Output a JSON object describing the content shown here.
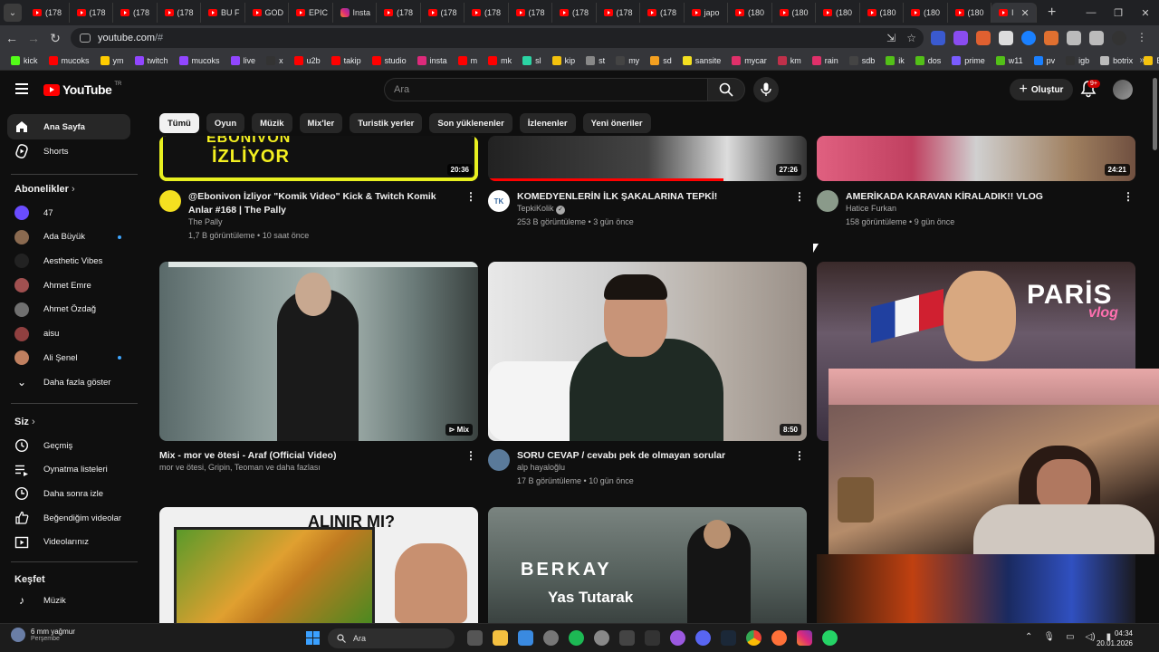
{
  "browser": {
    "tabs": [
      "(178",
      "(178",
      "(178",
      "(178",
      "BU F",
      "GOD",
      "EPIC",
      "Insta",
      "(178",
      "(178",
      "(178",
      "(178",
      "(178",
      "(178",
      "(178",
      "japo",
      "(180",
      "(180",
      "(180",
      "(180",
      "(180",
      "(180",
      "I"
    ],
    "tab_icons": [
      "yt",
      "yt",
      "yt",
      "yt",
      "yt",
      "yt",
      "yt",
      "ig",
      "yt",
      "yt",
      "yt",
      "yt",
      "yt",
      "yt",
      "yt",
      "yt",
      "yt",
      "yt",
      "yt",
      "yt",
      "yt",
      "yt",
      "yt"
    ],
    "url_host": "youtube.com",
    "url_path": "/#",
    "bookmarks": [
      {
        "label": "kick",
        "color": "#53fc18"
      },
      {
        "label": "mucoks",
        "color": "#ff0000"
      },
      {
        "label": "ym",
        "color": "#ffcc00"
      },
      {
        "label": "twitch",
        "color": "#9146ff"
      },
      {
        "label": "mucoks",
        "color": "#9146ff"
      },
      {
        "label": "live",
        "color": "#9146ff"
      },
      {
        "label": "x",
        "color": "#333333"
      },
      {
        "label": "u2b",
        "color": "#ff0000"
      },
      {
        "label": "takip",
        "color": "#ff0000"
      },
      {
        "label": "studio",
        "color": "#ff0000"
      },
      {
        "label": "insta",
        "color": "#dd2a7b"
      },
      {
        "label": "m",
        "color": "#ff0000"
      },
      {
        "label": "mk",
        "color": "#ff0000"
      },
      {
        "label": "sl",
        "color": "#2bd4a4"
      },
      {
        "label": "kip",
        "color": "#f4c20d"
      },
      {
        "label": "st",
        "color": "#888888"
      },
      {
        "label": "my",
        "color": "#444444"
      },
      {
        "label": "sd",
        "color": "#f4a020"
      },
      {
        "label": "sansite",
        "color": "#f4e020"
      },
      {
        "label": "mycar",
        "color": "#e0306a"
      },
      {
        "label": "km",
        "color": "#c0304a"
      },
      {
        "label": "rain",
        "color": "#e0306a"
      },
      {
        "label": "sdb",
        "color": "#444444"
      },
      {
        "label": "ik",
        "color": "#53c018"
      },
      {
        "label": "dos",
        "color": "#53c018"
      },
      {
        "label": "prime",
        "color": "#7a5cff"
      },
      {
        "label": "w11",
        "color": "#53c018"
      },
      {
        "label": "pv",
        "color": "#1a80ff"
      },
      {
        "label": "igb",
        "color": "#333333"
      },
      {
        "label": "botrix",
        "color": "#bbbbbb"
      },
      {
        "label": "ByNo",
        "color": "#f4c20d"
      }
    ]
  },
  "header": {
    "logo": "YouTube",
    "logo_region": "TR",
    "search_placeholder": "Ara",
    "create_label": "Oluştur",
    "notif_count": "9+"
  },
  "sidebar": {
    "home": "Ana Sayfa",
    "shorts": "Shorts",
    "subs_title": "Abonelikler",
    "subs": [
      {
        "name": "47",
        "color": "#6a4cff",
        "dot": false
      },
      {
        "name": "Ada Büyük",
        "color": "#8a6a50",
        "dot": true
      },
      {
        "name": "Aesthetic Vibes",
        "color": "#222222",
        "dot": false
      },
      {
        "name": "Ahmet Emre",
        "color": "#a05050",
        "dot": false
      },
      {
        "name": "Ahmet Özdağ",
        "color": "#707070",
        "dot": false
      },
      {
        "name": "aisu",
        "color": "#904040",
        "dot": false
      },
      {
        "name": "Ali Şenel",
        "color": "#c08060",
        "dot": true
      }
    ],
    "show_more": "Daha fazla göster",
    "you_title": "Siz",
    "you_items": [
      "Geçmiş",
      "Oynatma listeleri",
      "Daha sonra izle",
      "Beğendiğim videolar",
      "Videolarınız"
    ],
    "explore_title": "Keşfet",
    "explore_items": [
      "Müzik"
    ]
  },
  "chips": [
    "Tümü",
    "Oyun",
    "Müzik",
    "Mix'ler",
    "Turistik yerler",
    "Son yüklenenler",
    "İzlenenler",
    "Yeni öneriler"
  ],
  "videos": [
    {
      "title": "@Ebonivon İzliyor \"Komik Video\" Kick & Twitch Komik Anlar #168 | The Pally",
      "channel": "The Pally",
      "stats": "1,7 B görüntüleme • 10 saat önce",
      "duration": "20:36",
      "avatar": "#f4e020"
    },
    {
      "title": "KOMEDYENLERİN İLK ŞAKALARINA TEPKİ!",
      "channel": "TepkiKolik",
      "verified": "✓",
      "stats": "253 B görüntüleme • 3 gün önce",
      "duration": "27:26",
      "avatar": "#3a6aa0",
      "avatar_text": "TK"
    },
    {
      "title": "AMERİKADA KARAVAN KİRALADIK!! VLOG",
      "channel": "Hatice Furkan",
      "stats": "158 görüntüleme • 9 gün önce",
      "duration": "24:21",
      "avatar": "#8a9a8a"
    },
    {
      "title": "Mix - mor ve ötesi - Araf (Official Video)",
      "channel": "mor ve ötesi, Gripin, Teoman ve daha fazlası",
      "duration": "Mix"
    },
    {
      "title": "SORU CEVAP / cevabı pek de olmayan sorular",
      "channel": "alp hayaloğlu",
      "stats": "17 B görüntüleme • 10 gün önce",
      "duration": "8:50",
      "avatar": "#5a7a9a"
    }
  ],
  "thumb_text": {
    "ebonivon_line1": "EBONIVON",
    "ebonivon_line2": "İZLİYOR",
    "paris_line1": "PARİS",
    "paris_line2": "vlog",
    "alinir": "ALINIR MI?",
    "berkay_line1": "BERKAY",
    "berkay_line2": "Yas Tutarak"
  },
  "taskbar": {
    "weather_temp": "6 mm yağmur",
    "weather_day": "Perşembe",
    "search": "Ara",
    "time": "04:34",
    "date": "20.01.2026"
  }
}
